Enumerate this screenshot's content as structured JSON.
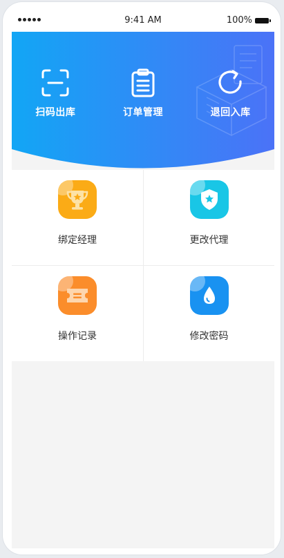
{
  "status_bar": {
    "time": "9:41 AM",
    "battery": "100%"
  },
  "colors": {
    "banner_start": "#12a6f5",
    "banner_end": "#4b72f7",
    "orange": "#fbab16",
    "cyan": "#19c6e6",
    "orange_red": "#fb8d2b",
    "blue": "#1992f1"
  },
  "quick_actions": [
    {
      "label": "扫码出库",
      "icon": "scan-icon"
    },
    {
      "label": "订单管理",
      "icon": "clipboard-icon"
    },
    {
      "label": "退回入库",
      "icon": "refresh-icon"
    }
  ],
  "menu": [
    {
      "label": "绑定经理",
      "icon": "trophy-icon"
    },
    {
      "label": "更改代理",
      "icon": "shield-star-icon"
    },
    {
      "label": "操作记录",
      "icon": "ticket-icon"
    },
    {
      "label": "修改密码",
      "icon": "water-drop-icon"
    }
  ]
}
